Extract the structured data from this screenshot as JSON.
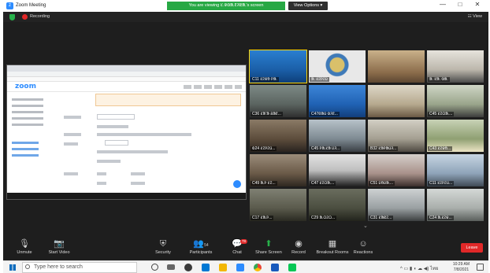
{
  "window": {
    "title": "Zoom Meeting",
    "banner": "You are viewing ᱥ.ᱫᱷᱟᱹᱱᱤᱭᱟᱹ's screen",
    "view_options": "View Options ▾",
    "minimize": "—",
    "maximize": "□",
    "close": "✕"
  },
  "subbar": {
    "recording": "Recording",
    "view": "☷ View"
  },
  "participants": [
    {
      "name": "C11 ᱥᱮᱫᱚ ᱞᱟᱹ"
    },
    {
      "name": "ᱟᱹ ᱥᱮᱞᱮᱡ"
    },
    {
      "name": ""
    },
    {
      "name": "ᱟᱹ ᱥᱟᱹ ᱵᱟᱹ"
    },
    {
      "name": "C36 ᱥᱟᱸᱟ ᱪᱟᱱ..."
    },
    {
      "name": "C47ᱜᱟᱢ ᱵᱤᱱ..."
    },
    {
      "name": ""
    },
    {
      "name": "C45 ᱥᱮᱛᱟᱹ..."
    },
    {
      "name": "ᱵ24 ᱥᱮᱞᱮᱢ..."
    },
    {
      "name": "C45 ᱞᱟᱹᱥᱟ ᱡᱤ..."
    },
    {
      "name": "B32 ᱥᱟᱞᱟᱢᱤ..."
    },
    {
      "name": "C43 ᱥᱮᱫᱚ..."
    },
    {
      "name": "C49 ᱟᱹᱞ ᱥᱮ..."
    },
    {
      "name": "C47 ᱥᱮᱛᱟᱹ..."
    },
    {
      "name": "C51 ᱡᱚᱡᱟᱹ..."
    },
    {
      "name": "C11 ᱥᱮᱞᱮᱢ..."
    },
    {
      "name": "C17 ᱥᱟᱹᱞ..."
    },
    {
      "name": "C29 ᱟᱹᱛᱮᱛ..."
    },
    {
      "name": "C31 ᱥᱟᱭᱮ..."
    },
    {
      "name": "C24 ᱟᱹᱥᱮᱫ..."
    }
  ],
  "toolbar": {
    "unmute": "Unmute",
    "start_video": "Start Video",
    "security": "Security",
    "participants": "Participants",
    "participants_count": "54",
    "chat": "Chat",
    "chat_badge": "78",
    "share_screen": "Share Screen",
    "record": "Record",
    "breakout": "Breakout Rooms",
    "reactions": "Reactions",
    "leave": "Leave"
  },
  "taskbar": {
    "search_placeholder": "Type here to search",
    "time": "10:29 AM",
    "date": "7/8/2021",
    "lang": "ไทย"
  },
  "shared": {
    "logo": "zoom"
  },
  "colors": {
    "banner": "#27a844",
    "leave": "#e02828",
    "zoom_blue": "#2d8cff"
  }
}
